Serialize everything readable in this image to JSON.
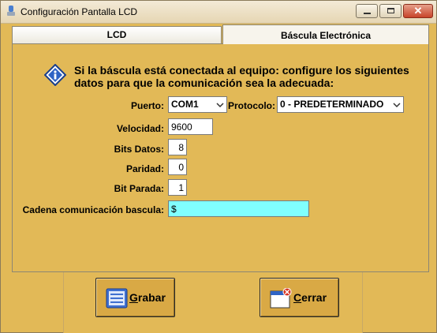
{
  "window": {
    "title": "Configuración Pantalla LCD",
    "close_glyph": "✕"
  },
  "tabs": [
    {
      "label": "LCD",
      "selected": false
    },
    {
      "label": "Báscula Electrónica",
      "selected": true
    }
  ],
  "info": {
    "icon": "info-diamond-icon",
    "text": "Si la báscula está conectada al equipo: configure los siguientes datos para que la comunicación sea la adecuada:"
  },
  "form": {
    "puerto_label": "Puerto:",
    "puerto_value": "COM1",
    "protocolo_label": "Protocolo:",
    "protocolo_value": "0 - PREDETERMINADO",
    "velocidad_label": "Velocidad:",
    "velocidad_value": "9600",
    "bits_datos_label": "Bits Datos:",
    "bits_datos_value": "8",
    "paridad_label": "Paridad:",
    "paridad_value": "0",
    "bit_parada_label": "Bit Parada:",
    "bit_parada_value": "1",
    "cadena_label": "Cadena comunicación bascula:",
    "cadena_value": "$"
  },
  "buttons": {
    "grabar_accel": "G",
    "grabar_rest": "rabar",
    "cerrar_accel": "C",
    "cerrar_rest": "errar"
  },
  "colors": {
    "background": "#e2b957",
    "cadena_field": "#80ffff"
  }
}
